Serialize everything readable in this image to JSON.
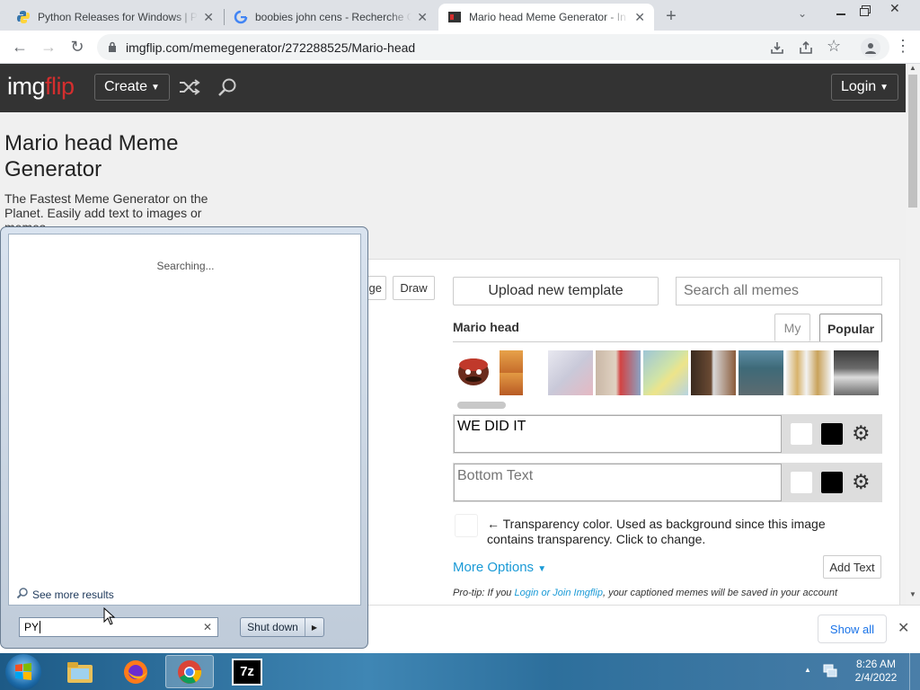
{
  "browser": {
    "tabs": [
      {
        "title": "Python Releases for Windows | P",
        "icon": "python-icon"
      },
      {
        "title": "boobies john cens - Recherche G",
        "icon": "google-icon"
      },
      {
        "title": "Mario head Meme Generator - In",
        "icon": "imgflip-icon"
      }
    ],
    "url": "imgflip.com/memegenerator/272288525/Mario-head"
  },
  "site": {
    "logo_img": "img",
    "logo_flip": "flip",
    "create_label": "Create",
    "login_label": "Login"
  },
  "page": {
    "title": "Mario head Meme Generator",
    "subtitle": "The Fastest Meme Generator on the Planet. Easily add text to images or memes.",
    "tab_image_fragment": "ge",
    "draw_label": "Draw",
    "upload_label": "Upload new template",
    "search_placeholder": "Search all memes",
    "template_name": "Mario head",
    "tab_my": "My",
    "tab_popular": "Popular",
    "top_text_value": "WE DID IT",
    "bottom_text_placeholder": "Bottom Text",
    "transparency_text": "← Transparency color. Used as background since this image contains transparency. Click to change.",
    "more_options": "More Options",
    "add_text": "Add Text",
    "protip_label": "Pro-tip:",
    "protip_pre": " If you ",
    "protip_link": "Login or Join Imgflip",
    "protip_post": ", your captioned memes will be saved in your account",
    "show_all": "Show all"
  },
  "start_menu": {
    "searching": "Searching...",
    "see_more": "See more results",
    "search_value": "PY",
    "shutdown_label": "Shut down"
  },
  "taskbar": {
    "time": "8:26 AM",
    "date": "2/4/2022",
    "apps": [
      "explorer-icon",
      "firefox-icon",
      "chrome-icon",
      "7zip-icon"
    ]
  },
  "colors": {
    "imgflip_red": "#d42e2e",
    "link_blue": "#1a9ad6",
    "header_dark": "#333333"
  }
}
